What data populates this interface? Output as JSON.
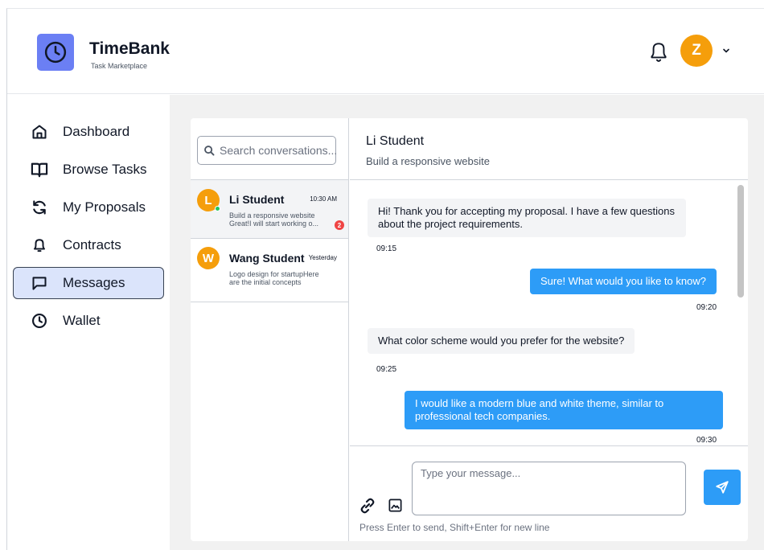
{
  "header": {
    "brand_title": "TimeBank",
    "brand_subtitle": "Task Marketplace",
    "user_initial": "Z"
  },
  "sidebar": {
    "items": [
      {
        "label": "Dashboard",
        "icon": "home-icon",
        "active": false
      },
      {
        "label": "Browse Tasks",
        "icon": "book-icon",
        "active": false
      },
      {
        "label": "My Proposals",
        "icon": "refresh-icon",
        "active": false
      },
      {
        "label": "Contracts",
        "icon": "bell-icon",
        "active": false
      },
      {
        "label": "Messages",
        "icon": "message-icon",
        "active": true
      },
      {
        "label": "Wallet",
        "icon": "clock-icon",
        "active": false
      }
    ]
  },
  "conversations": {
    "search_placeholder": "Search conversations...",
    "items": [
      {
        "initial": "L",
        "name": "Li Student",
        "time": "10:30 AM",
        "preview_line1": "Build a responsive website",
        "preview_line2": "Great!I will start working o...",
        "unread": "2",
        "online": true,
        "selected": true
      },
      {
        "initial": "W",
        "name": "Wang Student",
        "time": "Yesterday",
        "preview_line1": "Logo design for startupHere",
        "preview_line2": "are the initial concepts",
        "unread": "",
        "online": false,
        "selected": false
      }
    ]
  },
  "chat": {
    "contact_name": "Li Student",
    "task_title": "Build a responsive website",
    "messages": [
      {
        "direction": "in",
        "text": "Hi! Thank you for accepting my proposal. I have a few questions about the project requirements.",
        "time": "09:15"
      },
      {
        "direction": "out",
        "text": "Sure! What would you like to know?",
        "time": "09:20"
      },
      {
        "direction": "in",
        "text": "What color scheme would you prefer for the website?",
        "time": "09:25"
      },
      {
        "direction": "out",
        "text": "I would like a modern blue and white theme, similar to professional tech companies.",
        "time": "09:30"
      }
    ],
    "input_placeholder": "Type your message...",
    "hint": "Press Enter to send, Shift+Enter for new line"
  },
  "colors": {
    "brand": "#6b7ff4",
    "accent": "#2d9cf7",
    "avatar": "#f59e0b",
    "active_nav_bg": "#dbe4fb",
    "unread": "#ef4444",
    "online": "#22c55e"
  }
}
